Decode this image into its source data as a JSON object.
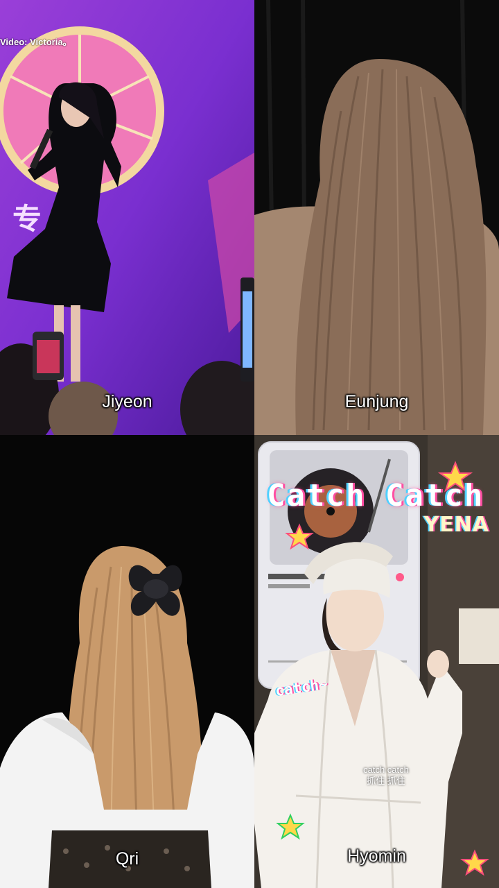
{
  "panels": {
    "top_left": {
      "caption": "Jiyeon",
      "credit": "Video: Victoria。"
    },
    "top_right": {
      "caption": "Eunjung"
    },
    "bottom_left": {
      "caption": "Qri"
    },
    "bottom_right": {
      "caption": "Hyomin",
      "title": "Catch Catch",
      "artist": "YENA",
      "sticker_text": "catch~",
      "lyric_line1": "catch catch",
      "lyric_line2": "抓住 抓住"
    }
  },
  "colors": {
    "stage_purple": "#7a2fd0",
    "wheel_pink": "#f07ab8",
    "curtain_black": "#0a0a0a",
    "hair_brown": "#8a6d58",
    "sweater_tan": "#a48770",
    "robe_white": "#f4f1ec",
    "blonde_hair": "#c99a6b"
  }
}
